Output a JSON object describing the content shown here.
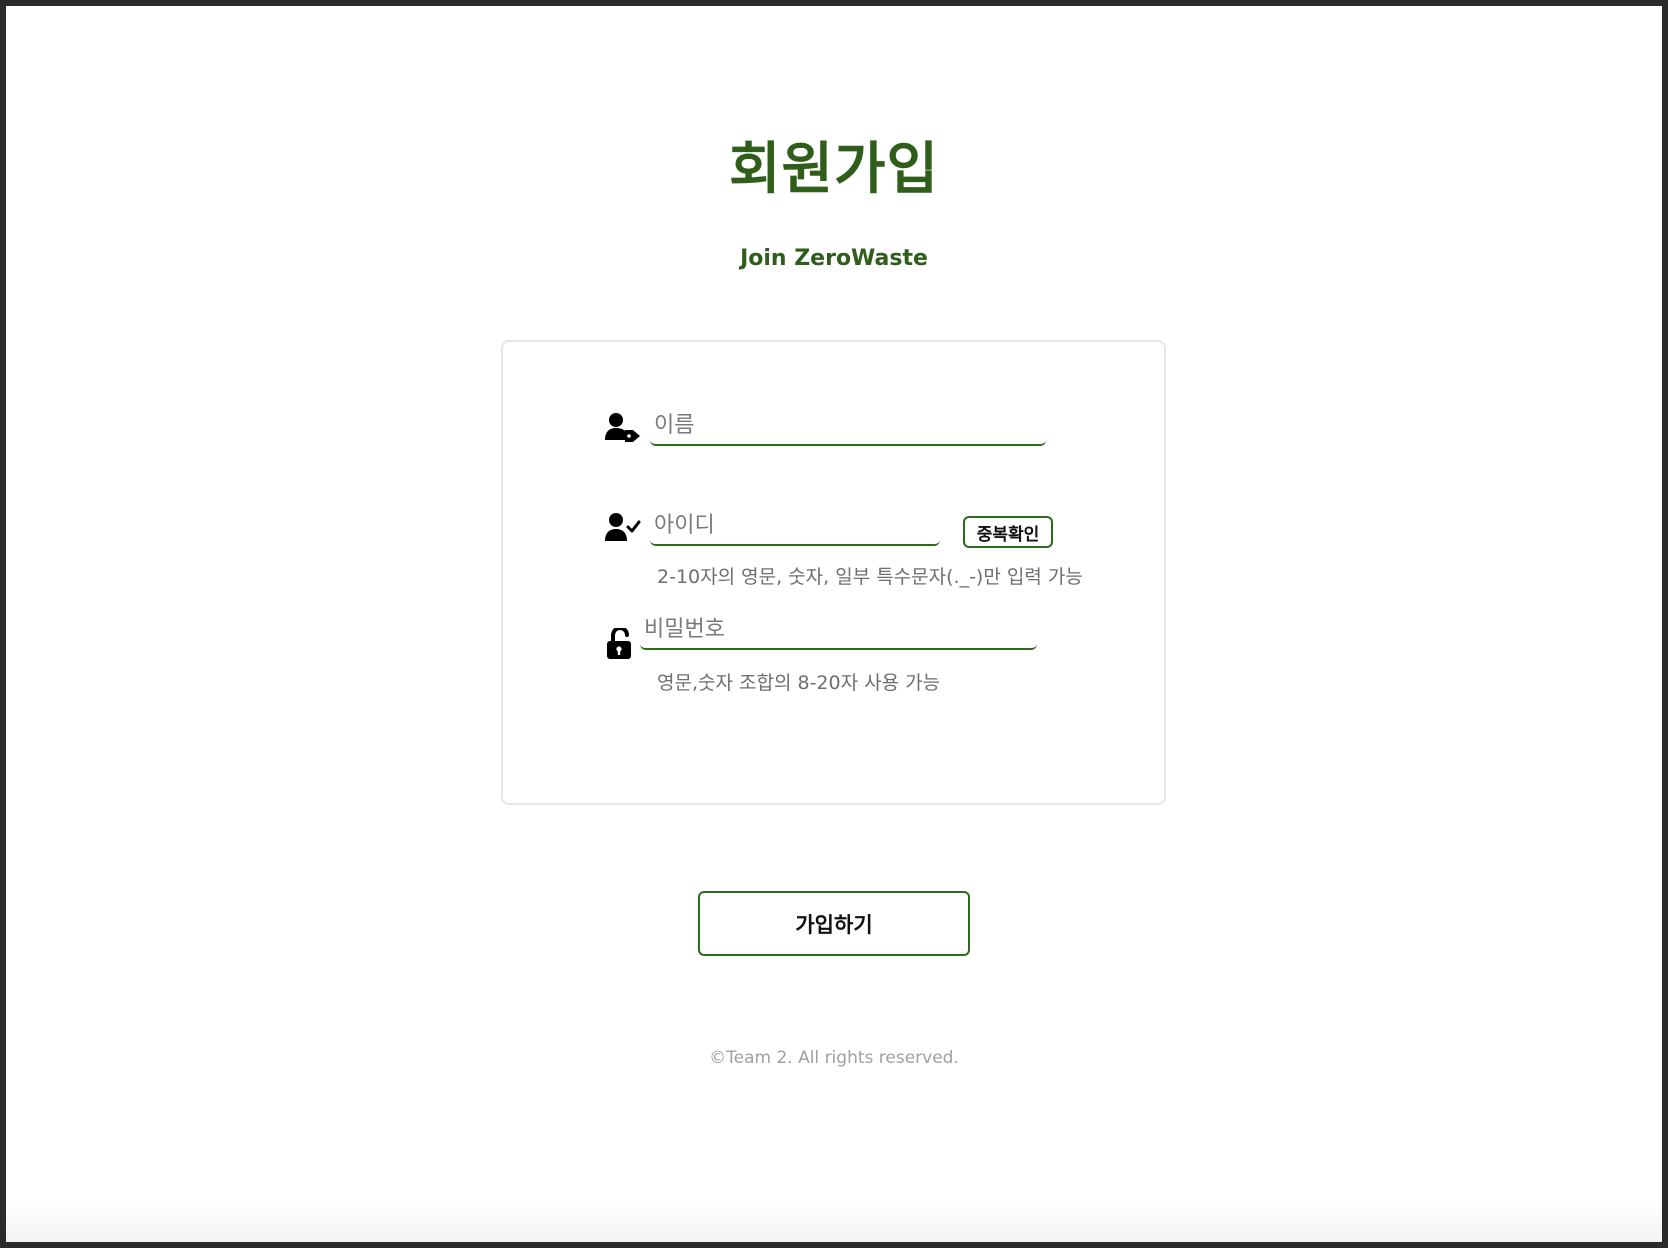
{
  "header": {
    "title": "회원가입",
    "subtitle": "Join ZeroWaste"
  },
  "form": {
    "name": {
      "icon": "user-tag-icon",
      "placeholder": "이름",
      "value": ""
    },
    "user_id": {
      "icon": "user-check-icon",
      "placeholder": "아이디",
      "value": "",
      "duplicate_check_label": "중복확인",
      "hint": "2-10자의 영문, 숫자, 일부 특수문자(._-)만 입력 가능"
    },
    "password": {
      "icon": "unlock-icon",
      "placeholder": "비밀번호",
      "value": "",
      "hint": "영문,숫자 조합의 8-20자 사용 가능"
    }
  },
  "actions": {
    "submit_label": "가입하기"
  },
  "footer": {
    "copyright": "©Team 2. All rights reserved."
  },
  "colors": {
    "accent": "#2e6a1e",
    "title": "#2e5e1a",
    "hint": "#6e6e6e",
    "footer": "#a0a0a0",
    "card_border": "#e6e6e6"
  }
}
